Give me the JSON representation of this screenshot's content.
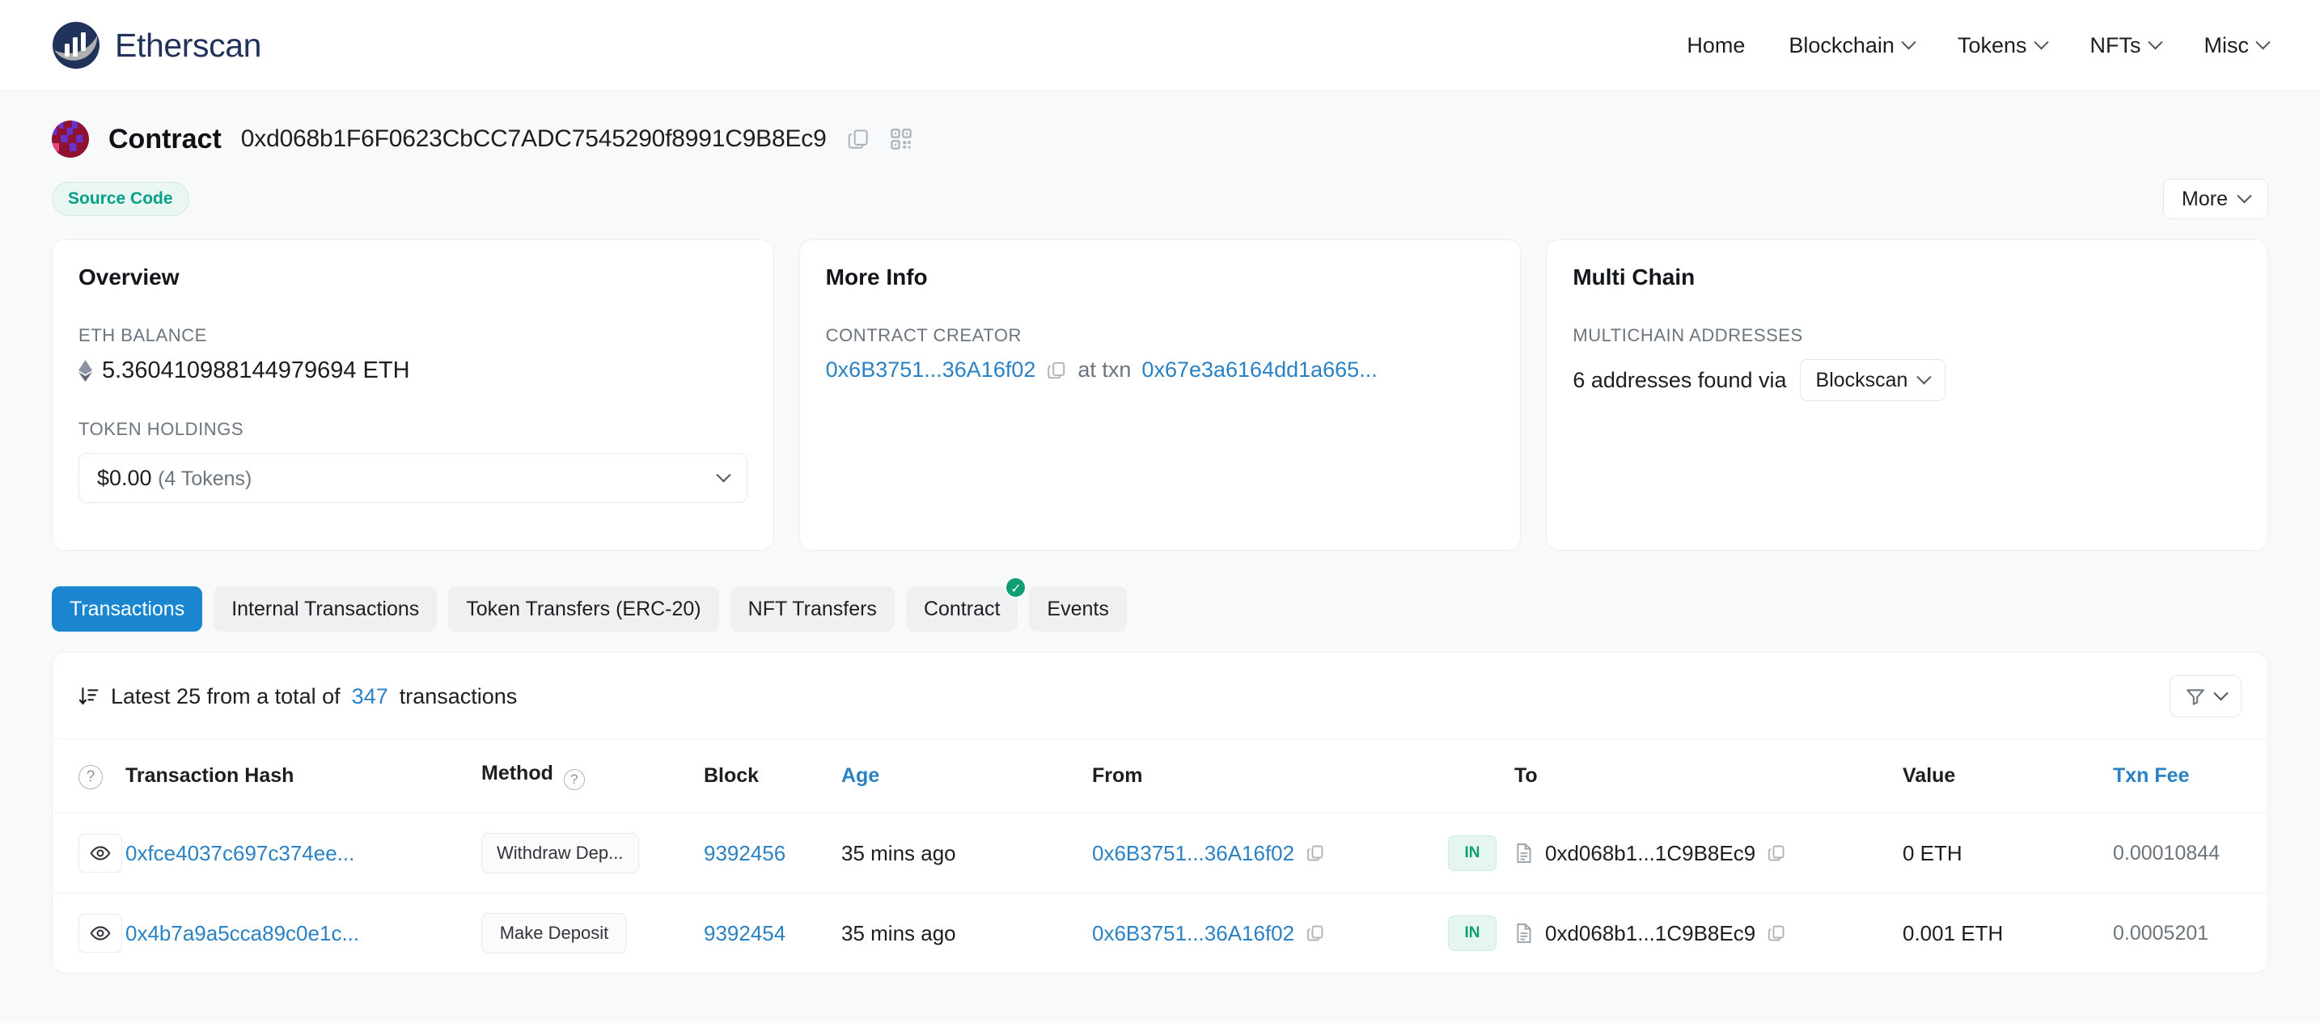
{
  "header": {
    "brand": "Etherscan",
    "nav": [
      {
        "label": "Home",
        "caret": false
      },
      {
        "label": "Blockchain",
        "caret": true
      },
      {
        "label": "Tokens",
        "caret": true
      },
      {
        "label": "NFTs",
        "caret": true
      },
      {
        "label": "Misc",
        "caret": true
      }
    ]
  },
  "title": {
    "label": "Contract",
    "address": "0xd068b1F6F0623CbCC7ADC7545290f8991C9B8Ec9",
    "copy_icon": "copy-icon",
    "qr_icon": "qr-code-icon"
  },
  "badges": {
    "source_code": "Source Code",
    "more_button": "More"
  },
  "overview": {
    "title": "Overview",
    "eth_balance_label": "ETH BALANCE",
    "eth_balance_value": "5.360410988144979694 ETH",
    "token_holdings_label": "TOKEN HOLDINGS",
    "token_value": "$0.00",
    "token_count": "(4 Tokens)"
  },
  "more_info": {
    "title": "More Info",
    "creator_label": "CONTRACT CREATOR",
    "creator_address": "0x6B3751...36A16f02",
    "at_txn_label": "at txn",
    "creation_txn": "0x67e3a6164dd1a665..."
  },
  "multi_chain": {
    "title": "Multi Chain",
    "addresses_label": "MULTICHAIN ADDRESSES",
    "found_text": "6 addresses found via",
    "provider": "Blockscan"
  },
  "tabs": [
    {
      "label": "Transactions",
      "active": true,
      "check": false
    },
    {
      "label": "Internal Transactions",
      "active": false,
      "check": false
    },
    {
      "label": "Token Transfers (ERC-20)",
      "active": false,
      "check": false
    },
    {
      "label": "NFT Transfers",
      "active": false,
      "check": false
    },
    {
      "label": "Contract",
      "active": false,
      "check": true
    },
    {
      "label": "Events",
      "active": false,
      "check": false
    }
  ],
  "txpanel": {
    "summary_prefix": "Latest 25 from a total of",
    "summary_count": "347",
    "summary_suffix": "transactions",
    "sort_icon": "sort-descending-icon",
    "filter_icon": "funnel-icon",
    "columns": {
      "help": "?",
      "hash": "Transaction Hash",
      "method": "Method",
      "method_help": "?",
      "block": "Block",
      "age": "Age",
      "from": "From",
      "to": "To",
      "value": "Value",
      "fee": "Txn Fee"
    },
    "rows": [
      {
        "eye_icon": "eye-icon",
        "hash": "0xfce4037c697c374ee...",
        "method": "Withdraw Dep...",
        "block": "9392456",
        "age": "35 mins ago",
        "from": "0x6B3751...36A16f02",
        "direction": "IN",
        "to": "0xd068b1...1C9B8Ec9",
        "value": "0 ETH",
        "fee": "0.00010844"
      },
      {
        "eye_icon": "eye-icon",
        "hash": "0x4b7a9a5cca89c0e1c...",
        "method": "Make Deposit",
        "block": "9392454",
        "age": "35 mins ago",
        "from": "0x6B3751...36A16f02",
        "direction": "IN",
        "to": "0xd068b1...1C9B8Ec9",
        "value": "0.001 ETH",
        "fee": "0.0005201"
      }
    ]
  },
  "colors": {
    "brand": "#21325b",
    "link": "#2a81c4",
    "active_tab": "#1a86d0",
    "success": "#0f9d72",
    "badge_text": "#00a186",
    "page_bg": "#f8f9fa"
  }
}
